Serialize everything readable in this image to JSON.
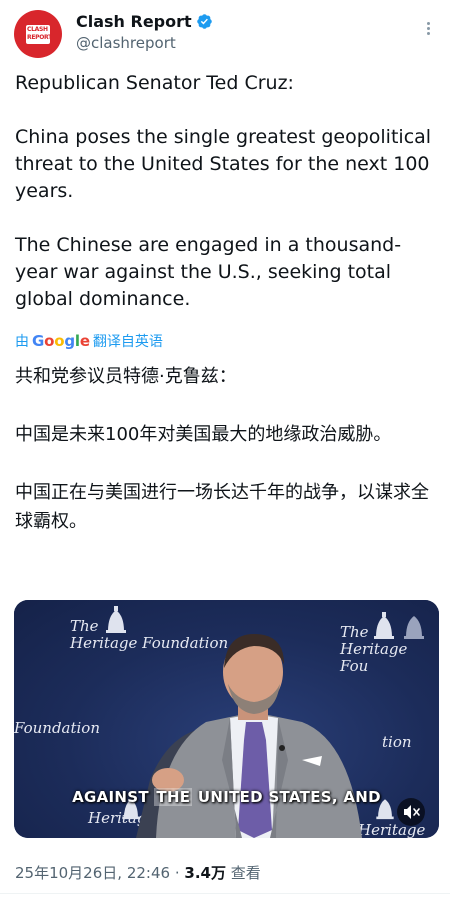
{
  "account": {
    "display_name": "Clash Report",
    "handle": "@clashreport",
    "avatar_text_line1": "CLASH",
    "avatar_text_line2": "REPORT",
    "avatar_color": "#d8262c",
    "verified_icon": "verified-badge-icon"
  },
  "tweet": {
    "text": "Republican Senator Ted Cruz:\n\nChina poses the single greatest geopolitical threat to the United States for the next 100 years.\n\nThe Chinese are engaged in a thousand-year war against the U.S., seeking total global dominance."
  },
  "translation": {
    "prefix": "由",
    "google_letters": [
      "G",
      "o",
      "o",
      "g",
      "l",
      "e"
    ],
    "suffix": "翻译自英语",
    "text": "共和党参议员特德·克鲁兹：\n\n中国是未来100年对美国最大的地缘政治威胁。\n\n中国正在与美国进行一场长达千年的战争，以谋求全球霸权。"
  },
  "media": {
    "brand_the": "The",
    "brand_name": "Heritage Foundation",
    "brand_partial_right": "Heritage Fou",
    "brand_partial_left": "Foundation",
    "brand_partial_bottom": "Heritage",
    "brand_partial_bottom_right": "Heritage F",
    "brand_partial_tion": "tion",
    "caption_before": "AGAINST ",
    "caption_highlight": "THE",
    "caption_after": " UNITED STATES, AND",
    "mute_icon": "speaker-muted-icon"
  },
  "meta": {
    "date": "25年10月26日",
    "time": "22:46",
    "separator": "·",
    "views_count": "3.4万",
    "views_label": "查看"
  },
  "colors": {
    "link": "#1d9bf0",
    "muted_text": "#536471",
    "video_bg": "#1e2f5e"
  }
}
